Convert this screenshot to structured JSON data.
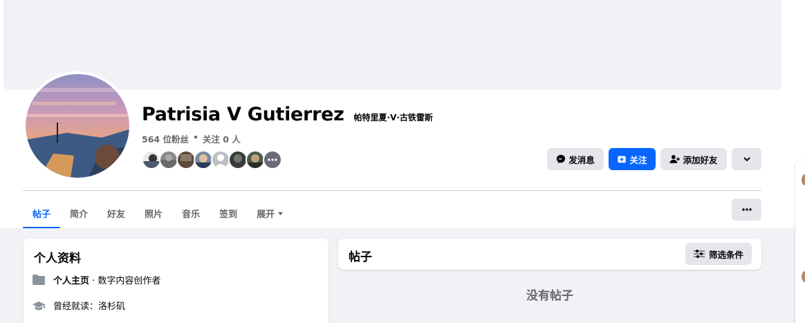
{
  "profile": {
    "name": "Patrisia V Gutierrez",
    "alt_name": "帕特里夏·V·古铁雷斯",
    "followers": "564 位粉丝",
    "separator": "•",
    "following": "关注 0 人"
  },
  "actions": {
    "message_label": "发消息",
    "follow_label": "关注",
    "add_friend_label": "添加好友"
  },
  "tabs": [
    {
      "label": "帖子",
      "active": true
    },
    {
      "label": "简介"
    },
    {
      "label": "好友"
    },
    {
      "label": "照片"
    },
    {
      "label": "音乐"
    },
    {
      "label": "签到"
    },
    {
      "label": "展开",
      "has_dropdown": true
    }
  ],
  "intro": {
    "title": "个人资料",
    "page_label": "个人主页",
    "page_category": " · 数字内容创作者",
    "education": "曾经就读：洛杉矶"
  },
  "posts": {
    "title": "帖子",
    "filter_label": "筛选条件",
    "empty": "没有帖子"
  },
  "colors": {
    "accent": "#0866ff",
    "secondary_button": "#e4e6eb",
    "page_background": "#f0f2f5",
    "muted_text": "#65676b"
  },
  "icons": {
    "message": "messenger-icon",
    "follow": "follow-plus-icon",
    "add_friend": "add-friend-icon",
    "more": "chevron-down-icon",
    "tab_more": "ellipsis-icon",
    "filter": "sliders-icon",
    "page": "folder-icon",
    "education": "graduation-cap-icon"
  }
}
